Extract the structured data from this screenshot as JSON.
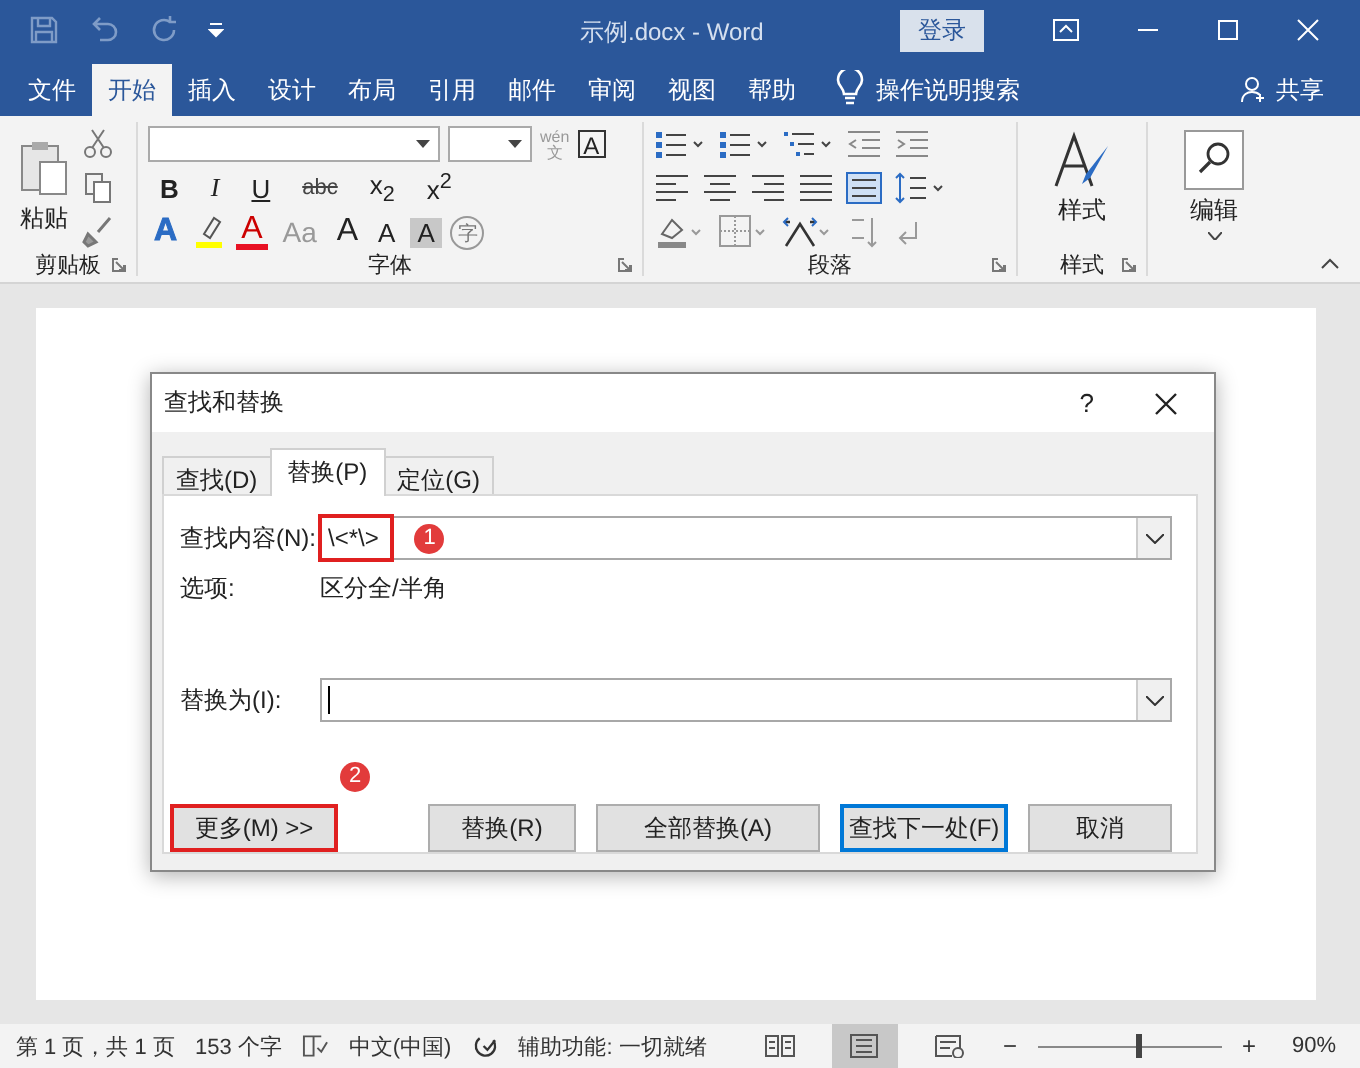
{
  "window": {
    "title": "示例.docx  -  Word",
    "sign_in": "登录"
  },
  "tabs": [
    {
      "label": "文件",
      "selected": false
    },
    {
      "label": "开始",
      "selected": true
    },
    {
      "label": "插入",
      "selected": false
    },
    {
      "label": "设计",
      "selected": false
    },
    {
      "label": "布局",
      "selected": false
    },
    {
      "label": "引用",
      "selected": false
    },
    {
      "label": "邮件",
      "selected": false
    },
    {
      "label": "审阅",
      "selected": false
    },
    {
      "label": "视图",
      "selected": false
    },
    {
      "label": "帮助",
      "selected": false
    }
  ],
  "tell_me": "操作说明搜索",
  "share": "共享",
  "ribbon": {
    "clipboard": {
      "paste": "粘贴",
      "label": "剪贴板"
    },
    "font": {
      "label": "字体",
      "phonetic_top": "wén",
      "phonetic_bottom": "文",
      "border_char": "A",
      "format": [
        "B",
        "I",
        "U",
        "abc",
        "x$_{2}$",
        "x$^{2}$"
      ],
      "effects": "A",
      "font_color": "A",
      "case": "Aa",
      "grow": "A",
      "shrink": "A",
      "shade": "A",
      "enclose": "字"
    },
    "paragraph": {
      "label": "段落"
    },
    "styles": {
      "button": "样式",
      "label": "样式"
    },
    "editing": {
      "button": "编辑"
    }
  },
  "dialog": {
    "title": "查找和替换",
    "help": "?",
    "tabs": [
      {
        "label": "查找(D)",
        "selected": false
      },
      {
        "label": "替换(P)",
        "selected": true
      },
      {
        "label": "定位(G)",
        "selected": false
      }
    ],
    "find": {
      "label": "查找内容(N):",
      "value": "\\<*\\>",
      "highlighted": true,
      "badge": "1"
    },
    "options": {
      "label": "选项:",
      "value": "区分全/半角"
    },
    "replace": {
      "label": "替换为(I):",
      "focused": true
    },
    "more": {
      "label": "更多(M) >>",
      "highlighted": true,
      "badge": "2"
    },
    "buttons": [
      {
        "label": "替换(R)",
        "default": false
      },
      {
        "label": "全部替换(A)",
        "default": false
      },
      {
        "label": "查找下一处(F)",
        "default": true
      },
      {
        "label": "取消",
        "default": false
      }
    ]
  },
  "status_bar": {
    "page": "第 1 页，共 1 页",
    "words": "153 个字",
    "language": "中文(中国)",
    "accessibility": "辅助功能: 一切就绪",
    "views": [
      {
        "kind": "read",
        "selected": false
      },
      {
        "kind": "print",
        "selected": true
      },
      {
        "kind": "web",
        "selected": false
      }
    ],
    "zoom": {
      "minus": "−",
      "plus": "+",
      "level": 0.55,
      "reading": "90%"
    }
  }
}
